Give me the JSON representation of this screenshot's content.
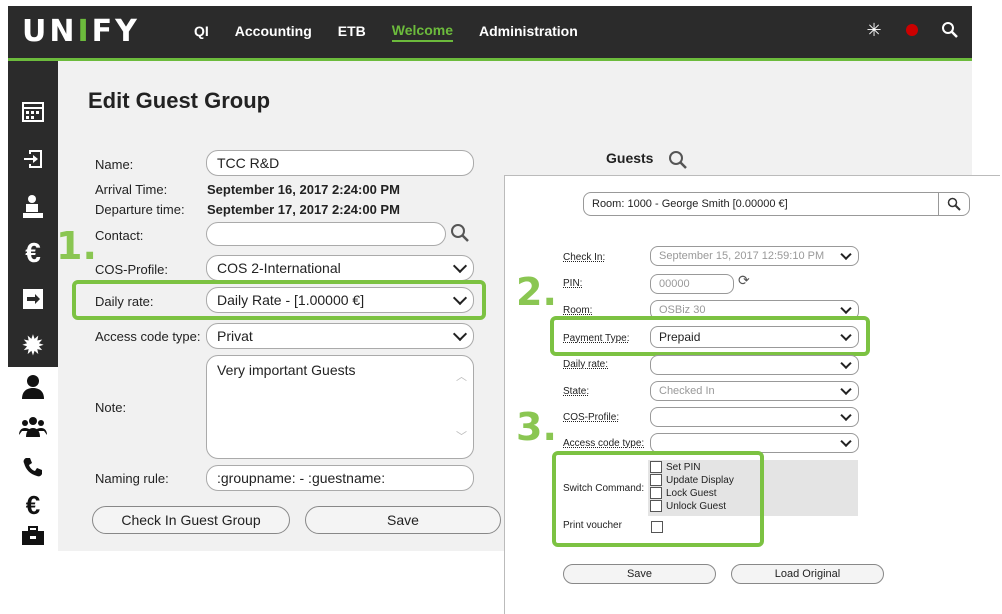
{
  "brand": {
    "logo_pre": "UN",
    "logo_i": "I",
    "logo_post": "FY"
  },
  "nav": [
    "QI",
    "Accounting",
    "ETB",
    "Welcome",
    "Administration"
  ],
  "active_nav": "Welcome",
  "sidebar_icons": [
    "calendar-icon",
    "login-icon",
    "cashier-icon",
    "euro-icon",
    "logout-icon",
    "gear-icon",
    "person-icon",
    "people-icon",
    "phone-icon",
    "euro-icon",
    "briefcase-icon"
  ],
  "edit": {
    "title": "Edit Guest Group",
    "name_label": "Name:",
    "name_value": "TCC R&D",
    "arrival_label": "Arrival Time:",
    "arrival_value": "September 16, 2017 2:24:00 PM",
    "departure_label": "Departure time:",
    "departure_value": "September 17, 2017 2:24:00 PM",
    "contact_label": "Contact:",
    "contact_value": "",
    "cos_label": "COS-Profile:",
    "cos_value": "COS 2-International",
    "daily_label": "Daily rate:",
    "daily_value": "Daily Rate - [1.00000 €]",
    "access_label": "Access code type:",
    "access_value": "Privat",
    "note_label": "Note:",
    "note_value": "Very important Guests",
    "naming_label": "Naming rule:",
    "naming_value": ":groupname: - :guestname:",
    "checkin_button": "Check In Guest Group",
    "save_button": "Save"
  },
  "guests": {
    "label": "Guests",
    "room_value": "Room: 1000 - George Smith  [0.00000 €]",
    "checkin_label": "Check In:",
    "checkin_value": "September 15, 2017 12:59:10 PM",
    "pin_label": "PIN:",
    "pin_value": "00000",
    "room_label": "Room:",
    "room_select": "OSBiz 30",
    "payment_label": "Payment Type:",
    "payment_value": "Prepaid",
    "daily_label": "Daily rate:",
    "daily_value": "",
    "state_label": "State:",
    "state_value": "Checked In",
    "cos_label": "COS-Profile:",
    "cos_value": "",
    "access_label": "Access code type:",
    "access_value": "",
    "switch_label": "Switch Command:",
    "switch_options": [
      "Set PIN",
      "Update Display",
      "Lock Guest",
      "Unlock Guest"
    ],
    "voucher_label": "Print voucher",
    "save_button": "Save",
    "load_button": "Load Original"
  },
  "steps": [
    "1.",
    "2.",
    "3."
  ],
  "accent_color": "#7cc242"
}
